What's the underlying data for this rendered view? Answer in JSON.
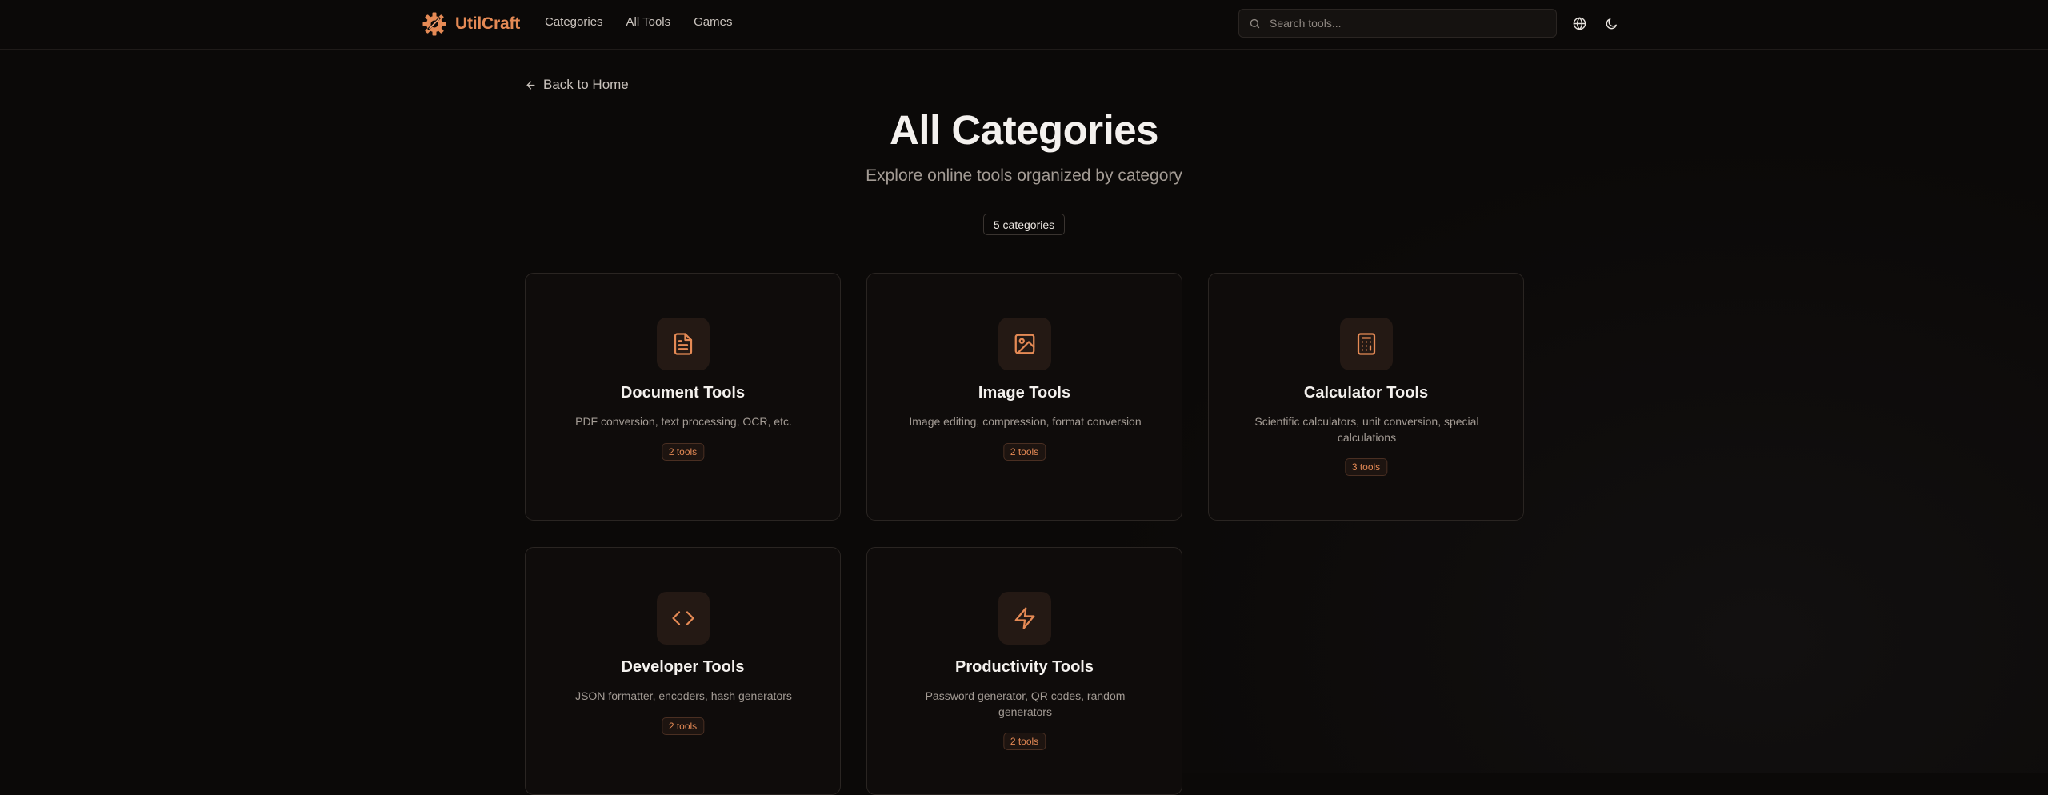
{
  "header": {
    "brand": "UtilCraft",
    "nav": [
      "Categories",
      "All Tools",
      "Games"
    ],
    "search_placeholder": "Search tools...",
    "language_icon": "globe-icon",
    "theme_icon": "moon-icon"
  },
  "main": {
    "back_label": "Back to Home",
    "title": "All Categories",
    "subtitle": "Explore online tools organized by category",
    "count_badge": "5 categories"
  },
  "categories": [
    {
      "title": "Document Tools",
      "description": "PDF conversion, text processing, OCR, etc.",
      "count": "2 tools",
      "icon": "document-icon"
    },
    {
      "title": "Image Tools",
      "description": "Image editing, compression, format conversion",
      "count": "2 tools",
      "icon": "image-icon"
    },
    {
      "title": "Calculator Tools",
      "description": "Scientific calculators, unit conversion, special calculations",
      "count": "3 tools",
      "icon": "calculator-icon"
    },
    {
      "title": "Developer Tools",
      "description": "JSON formatter, encoders, hash generators",
      "count": "2 tools",
      "icon": "code-icon"
    },
    {
      "title": "Productivity Tools",
      "description": "Password generator, QR codes, random generators",
      "count": "2 tools",
      "icon": "lightning-icon"
    }
  ],
  "colors": {
    "accent": "#e58a55",
    "background": "#0b0908",
    "card_background": "#0f0c0b",
    "card_border": "#2a2522"
  }
}
